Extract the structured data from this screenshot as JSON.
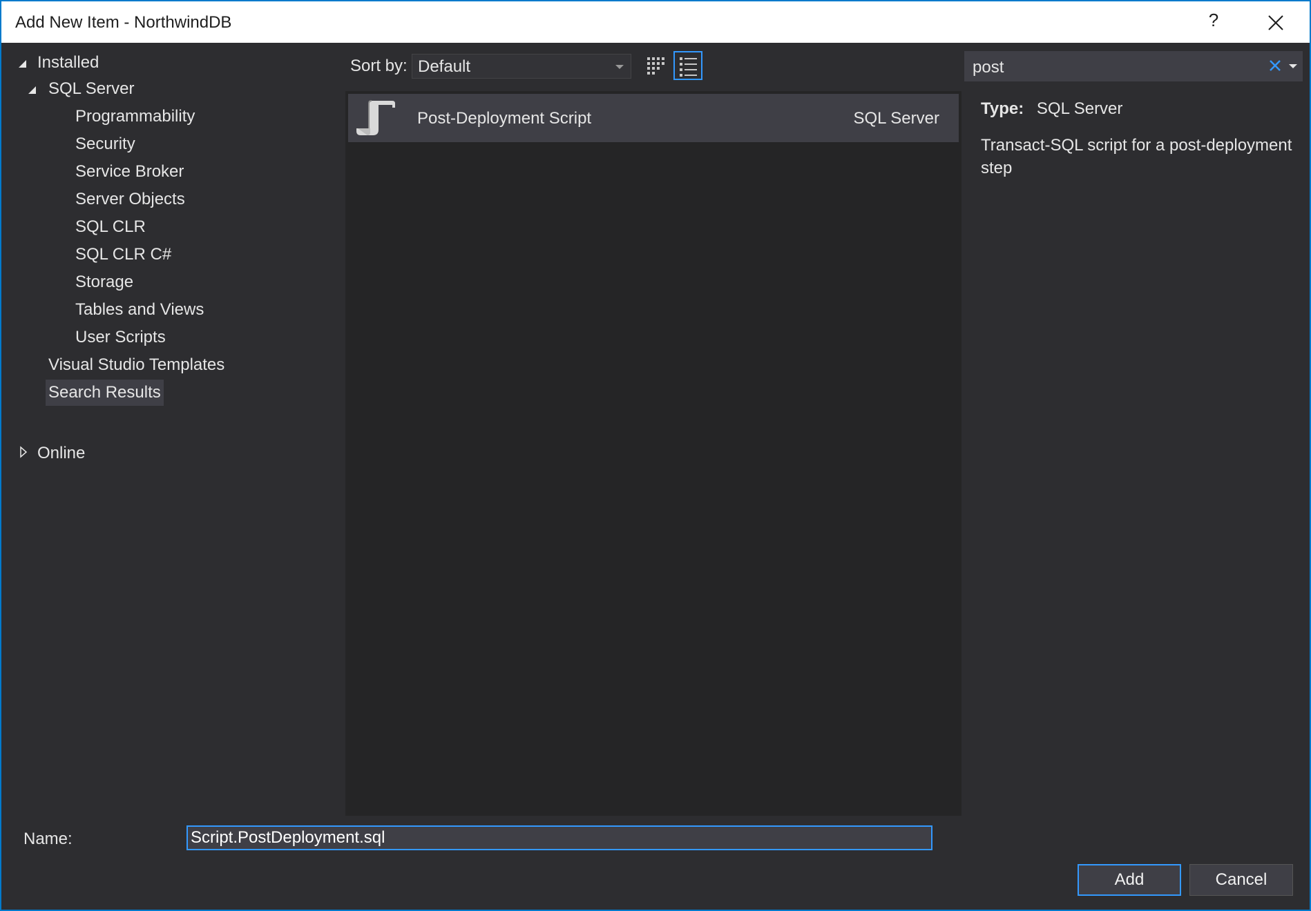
{
  "window": {
    "title": "Add New Item - NorthwindDB",
    "help_label": "?"
  },
  "tree": {
    "installed": "Installed",
    "sql_server": "SQL Server",
    "children": [
      "Programmability",
      "Security",
      "Service Broker",
      "Server Objects",
      "SQL CLR",
      "SQL CLR C#",
      "Storage",
      "Tables and Views",
      "User Scripts"
    ],
    "vs_templates": "Visual Studio Templates",
    "search_results": "Search Results",
    "online": "Online"
  },
  "toolbar": {
    "sort_label": "Sort by:",
    "sort_value": "Default",
    "icons": [
      "small-icons-view-icon",
      "list-view-icon"
    ]
  },
  "items": [
    {
      "name": "Post-Deployment Script",
      "category": "SQL Server",
      "icon": "sql-script-icon"
    }
  ],
  "search": {
    "value": "post"
  },
  "details": {
    "type_label": "Type:",
    "type_value": "SQL Server",
    "description": "Transact-SQL script for a post-deployment step"
  },
  "footer": {
    "name_label": "Name:",
    "name_value": "Script.PostDeployment.sql",
    "add_label": "Add",
    "cancel_label": "Cancel"
  },
  "colors": {
    "accent": "#3399ff",
    "background": "#2d2d30",
    "list_background": "#252526",
    "selection": "#3f3f46"
  }
}
